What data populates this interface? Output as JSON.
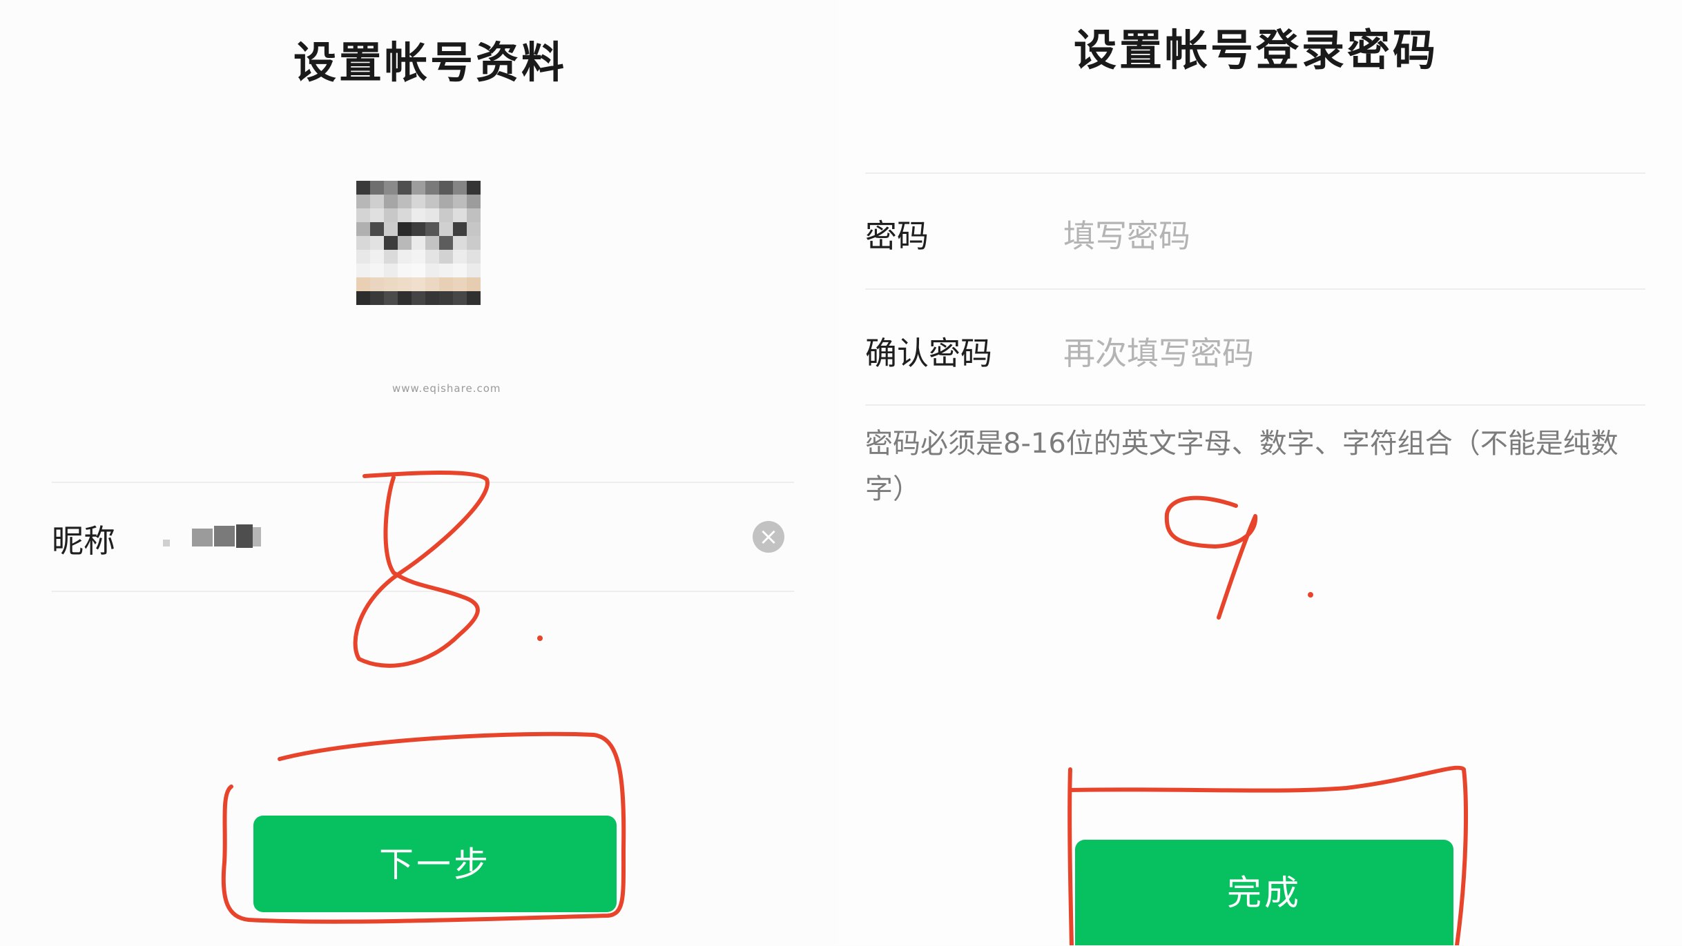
{
  "left_panel": {
    "title": "设置帐号资料",
    "watermark": "www.eqishare.com",
    "nickname_label": "昵称",
    "next_button_label": "下一步"
  },
  "right_panel": {
    "title": "设置帐号登录密码",
    "password_label": "密码",
    "password_placeholder": "填写密码",
    "confirm_label": "确认密码",
    "confirm_placeholder": "再次填写密码",
    "hint": "密码必须是8-16位的英文字母、数字、字符组合（不能是纯数字）",
    "done_button_label": "完成"
  },
  "icons": {
    "clear": "clear-circle-icon"
  },
  "colors": {
    "primary_button": "#07c160",
    "annotation_ink": "#e8442b"
  }
}
